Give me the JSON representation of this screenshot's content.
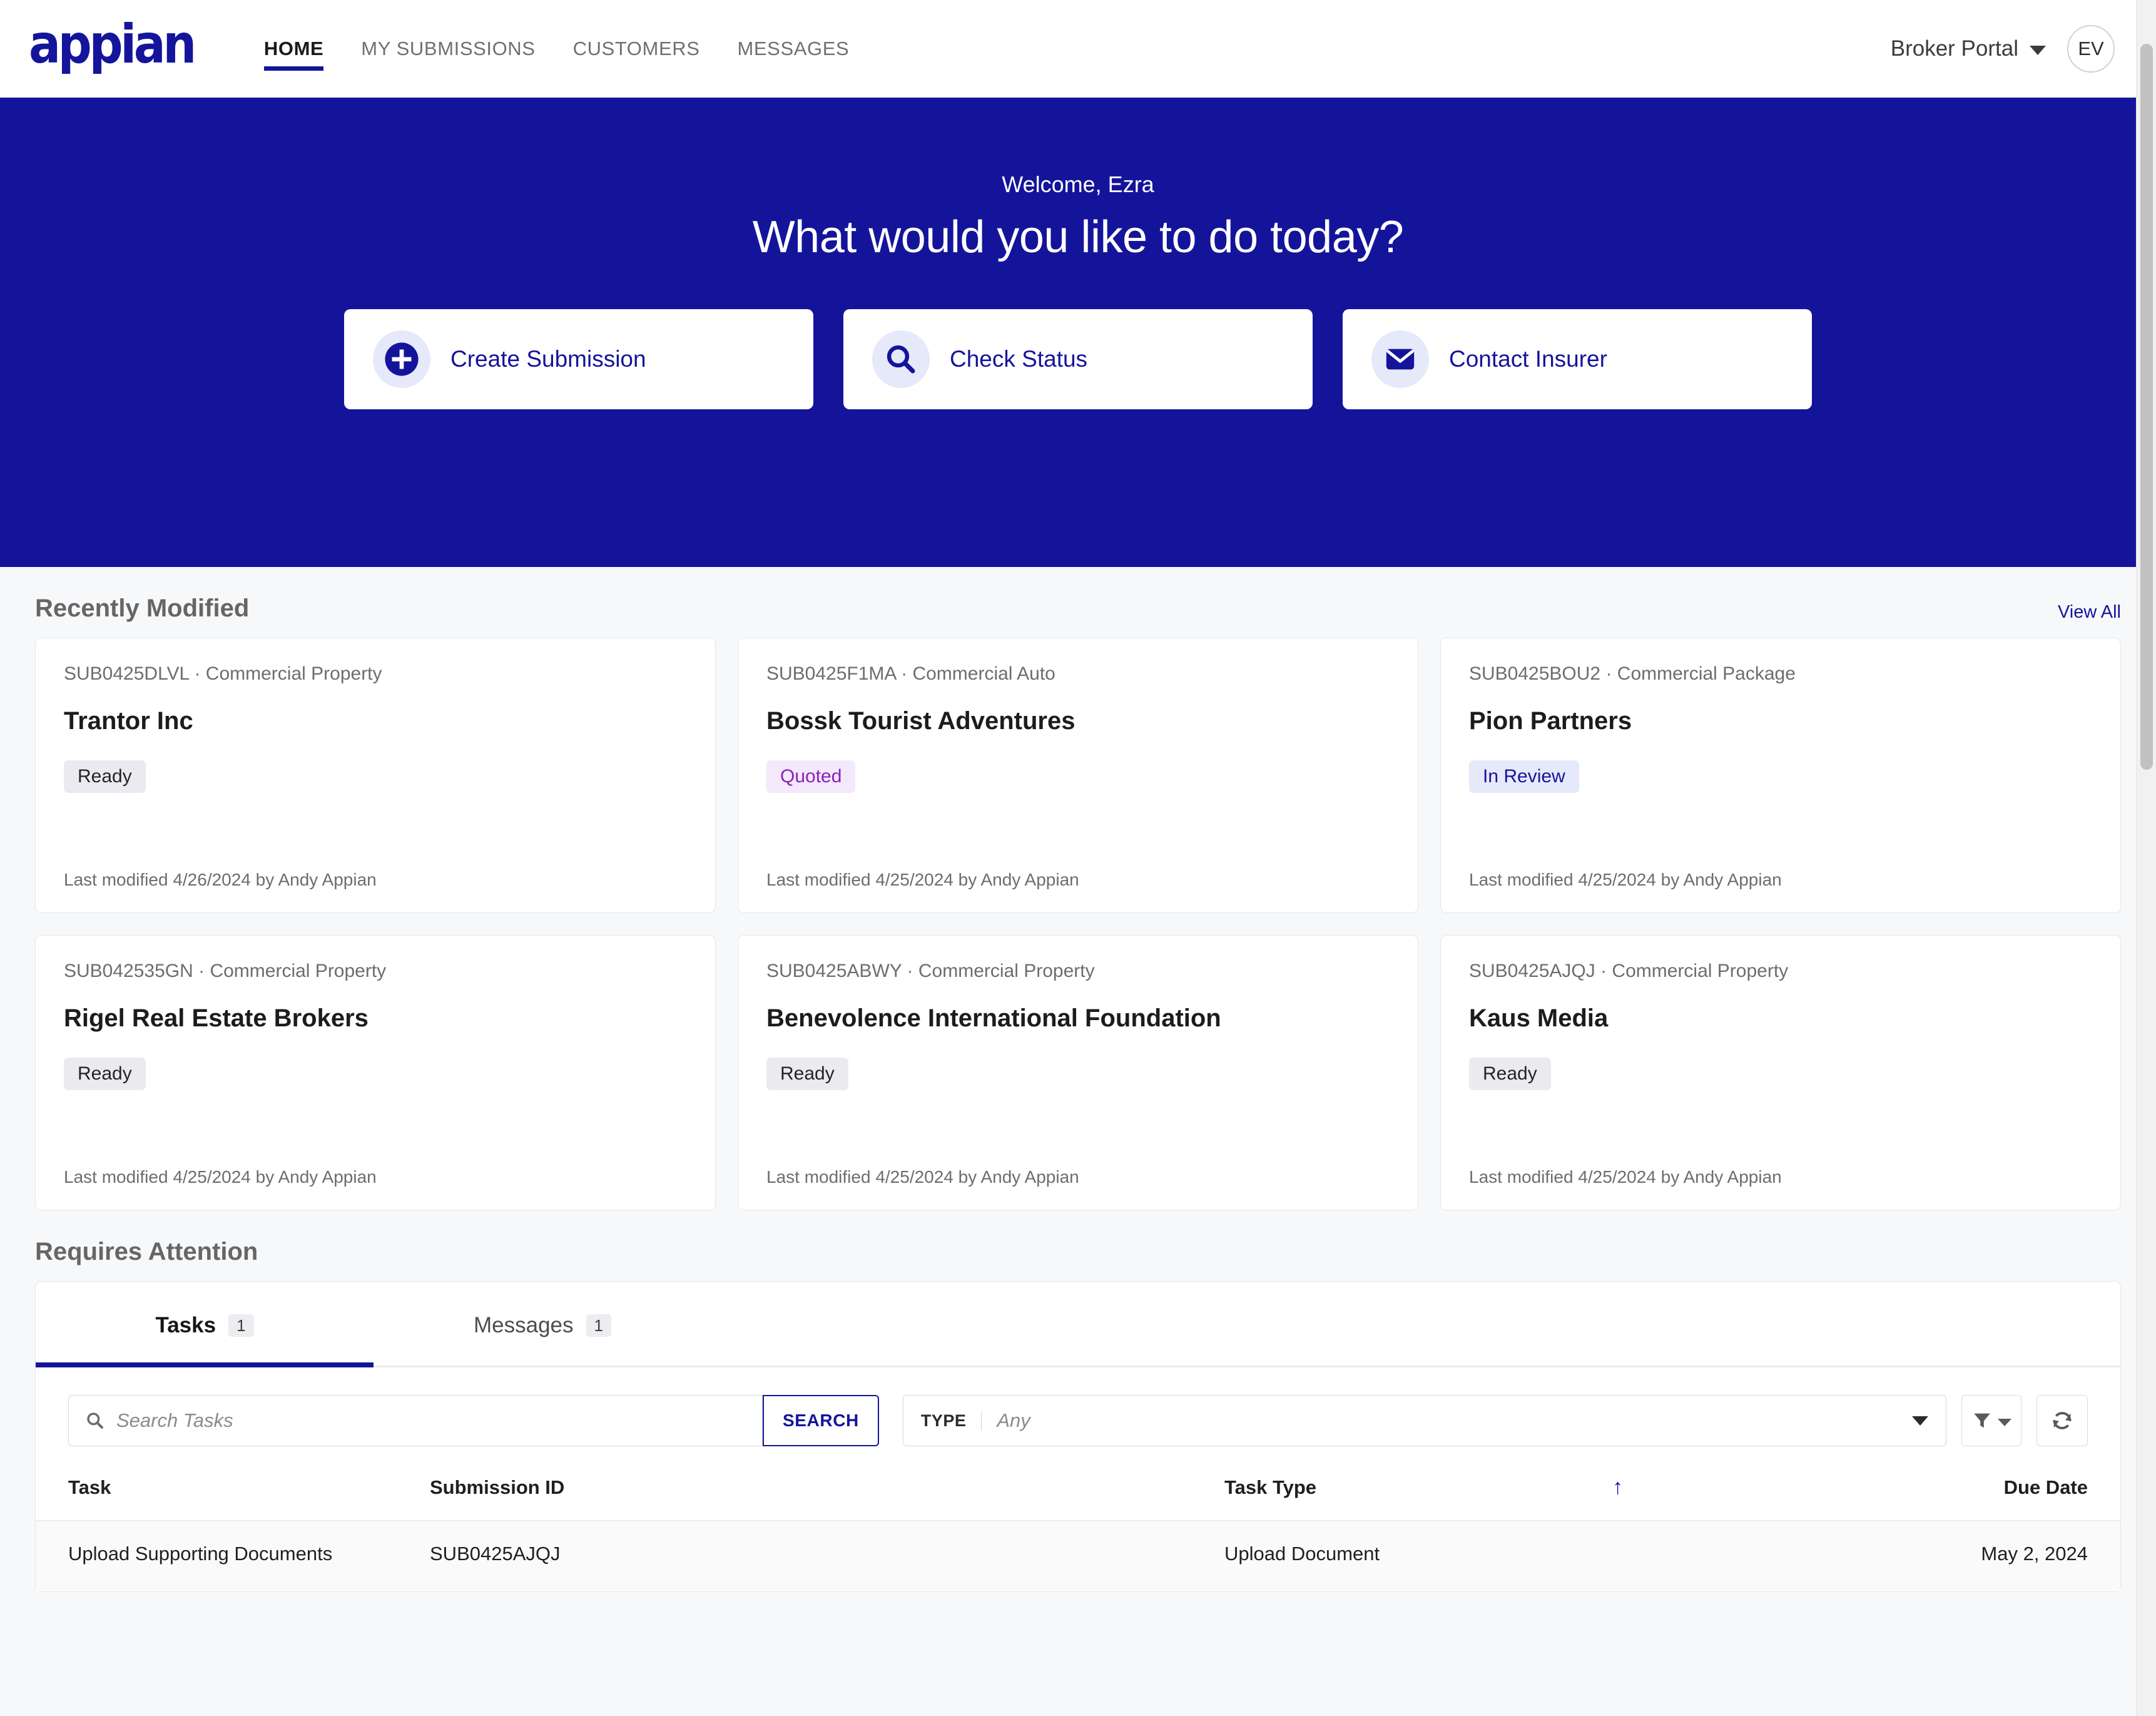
{
  "header": {
    "logo_text": "appian",
    "nav": [
      {
        "label": "HOME",
        "active": true
      },
      {
        "label": "MY SUBMISSIONS",
        "active": false
      },
      {
        "label": "CUSTOMERS",
        "active": false
      },
      {
        "label": "MESSAGES",
        "active": false
      }
    ],
    "portal_label": "Broker Portal",
    "avatar_initials": "EV"
  },
  "hero": {
    "welcome": "Welcome, Ezra",
    "title": "What would you like to do today?",
    "actions": [
      {
        "label": "Create Submission",
        "icon": "plus-circle-icon"
      },
      {
        "label": "Check Status",
        "icon": "search-icon"
      },
      {
        "label": "Contact Insurer",
        "icon": "envelope-icon"
      }
    ]
  },
  "recently_modified": {
    "title": "Recently Modified",
    "view_all": "View All",
    "cards": [
      {
        "meta": "SUB0425DLVL · Commercial Property",
        "name": "Trantor Inc",
        "status": "Ready",
        "status_class": "ready",
        "modified": "Last modified 4/26/2024 by Andy Appian"
      },
      {
        "meta": "SUB0425F1MA · Commercial Auto",
        "name": "Bossk Tourist Adventures",
        "status": "Quoted",
        "status_class": "quoted",
        "modified": "Last modified 4/25/2024 by Andy Appian"
      },
      {
        "meta": "SUB0425BOU2 · Commercial Package",
        "name": "Pion Partners",
        "status": "In Review",
        "status_class": "review",
        "modified": "Last modified 4/25/2024 by Andy Appian"
      },
      {
        "meta": "SUB042535GN · Commercial Property",
        "name": "Rigel Real Estate Brokers",
        "status": "Ready",
        "status_class": "ready",
        "modified": "Last modified 4/25/2024 by Andy Appian"
      },
      {
        "meta": "SUB0425ABWY · Commercial Property",
        "name": "Benevolence International Foundation",
        "status": "Ready",
        "status_class": "ready",
        "modified": "Last modified 4/25/2024 by Andy Appian"
      },
      {
        "meta": "SUB0425AJQJ · Commercial Property",
        "name": "Kaus Media",
        "status": "Ready",
        "status_class": "ready",
        "modified": "Last modified 4/25/2024 by Andy Appian"
      }
    ]
  },
  "requires_attention": {
    "title": "Requires Attention",
    "tabs": [
      {
        "label": "Tasks",
        "count": "1",
        "active": true
      },
      {
        "label": "Messages",
        "count": "1",
        "active": false
      }
    ],
    "toolbar": {
      "search_placeholder": "Search Tasks",
      "search_value": "",
      "search_button": "SEARCH",
      "type_label": "TYPE",
      "type_value": "Any",
      "filter_icon": "funnel-icon",
      "refresh_icon": "refresh-icon"
    },
    "table": {
      "columns": [
        "Task",
        "Submission ID",
        "Task Type",
        "",
        "Due Date"
      ],
      "sort_indicator": "↑",
      "rows": [
        {
          "task": "Upload Supporting Documents",
          "submission_id": "SUB0425AJQJ",
          "task_type": "Upload Document",
          "due_date": "May 2, 2024"
        }
      ]
    }
  },
  "colors": {
    "brand_navy": "#14149b",
    "page_bg": "#f7f8fa",
    "badge_quoted": "#8a21b8",
    "badge_review": "#14149b"
  }
}
